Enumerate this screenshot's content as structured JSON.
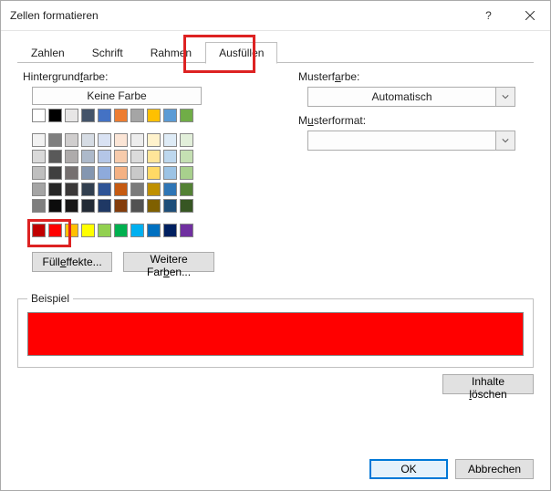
{
  "window": {
    "title": "Zellen formatieren"
  },
  "tabs": {
    "zahlen": "Zahlen",
    "schrift": "Schrift",
    "rahmen": "Rahmen",
    "ausfuellen": "Ausfüllen"
  },
  "left": {
    "bg_label": "Hintergrundfarbe:",
    "no_color": "Keine Farbe",
    "fill_effects": "Fülleffekte...",
    "more_colors": "Weitere Farben..."
  },
  "right": {
    "pattern_color_label": "Musterfarbe:",
    "pattern_color_value": "Automatisch",
    "pattern_format_label": "Musterformat:"
  },
  "example": {
    "label": "Beispiel",
    "color": "#ff0000"
  },
  "buttons": {
    "clear": "Inhalte löschen",
    "ok": "OK",
    "cancel": "Abbrechen"
  },
  "palettes": {
    "row1": [
      "#ffffff",
      "#000000",
      "#e7e6e6",
      "#44546a",
      "#4472c4",
      "#ed7d31",
      "#a5a5a5",
      "#ffc000",
      "#5b9bd5",
      "#70ad47"
    ],
    "big": [
      [
        "#f2f2f2",
        "#7f7f7f",
        "#d0cece",
        "#d6dce4",
        "#d9e2f3",
        "#fbe5d6",
        "#ededed",
        "#fff2cc",
        "#deebf6",
        "#e2efda"
      ],
      [
        "#d9d9d9",
        "#595959",
        "#aeabab",
        "#adb9ca",
        "#b4c6e7",
        "#f7cbac",
        "#dbdbdb",
        "#ffe599",
        "#bdd7ee",
        "#c5e0b3"
      ],
      [
        "#bfbfbf",
        "#3f3f3f",
        "#757070",
        "#8496b0",
        "#8eaadb",
        "#f4b183",
        "#c9c9c9",
        "#ffd965",
        "#9cc3e5",
        "#a8d08d"
      ],
      [
        "#a5a5a5",
        "#262626",
        "#3a3838",
        "#323f4f",
        "#2f5496",
        "#c55a11",
        "#7b7b7b",
        "#bf9000",
        "#2e75b5",
        "#538135"
      ],
      [
        "#7f7f7f",
        "#0c0c0c",
        "#171616",
        "#222a35",
        "#1f3864",
        "#833c0b",
        "#525252",
        "#7f6000",
        "#1e4e79",
        "#375623"
      ]
    ],
    "standard": [
      "#c00000",
      "#ff0000",
      "#ffc000",
      "#ffff00",
      "#92d050",
      "#00b050",
      "#00b0f0",
      "#0070c0",
      "#002060",
      "#7030a0"
    ]
  }
}
